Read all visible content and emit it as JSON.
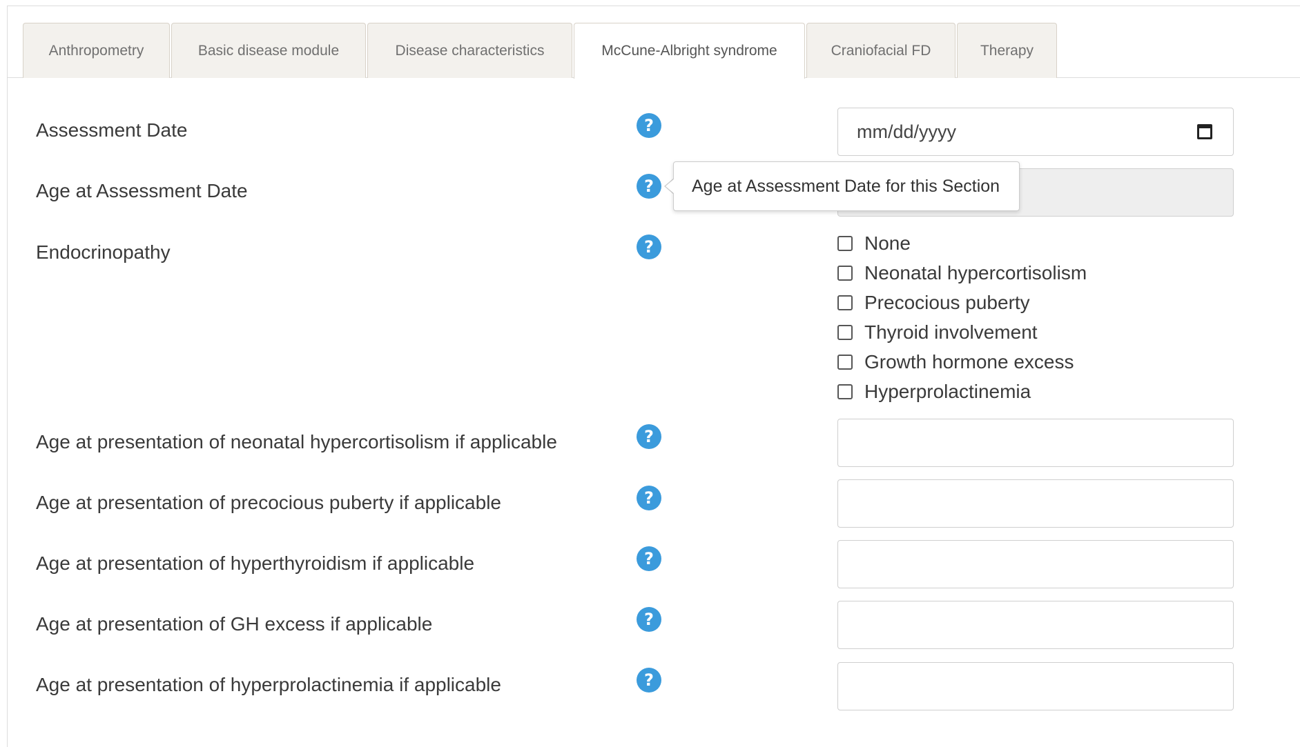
{
  "tabs": [
    {
      "label": "Anthropometry",
      "active": false
    },
    {
      "label": "Basic disease module",
      "active": false
    },
    {
      "label": "Disease characteristics",
      "active": false
    },
    {
      "label": "McCune-Albright syndrome",
      "active": true
    },
    {
      "label": "Craniofacial FD",
      "active": false
    },
    {
      "label": "Therapy",
      "active": false
    }
  ],
  "help_glyph": "?",
  "fields": {
    "assessment_date": {
      "label": "Assessment Date",
      "placeholder": "mm/dd/yyyy",
      "value": ""
    },
    "age_at_assessment": {
      "label": "Age at Assessment Date",
      "value": ""
    },
    "endocrinopathy": {
      "label": "Endocrinopathy",
      "options": [
        "None",
        "Neonatal hypercortisolism",
        "Precocious puberty",
        "Thyroid involvement",
        "Growth hormone excess",
        "Hyperprolactinemia"
      ]
    },
    "age_neonatal": {
      "label": "Age at presentation of neonatal hypercortisolism if applicable",
      "value": ""
    },
    "age_puberty": {
      "label": "Age at presentation of precocious puberty if applicable",
      "value": ""
    },
    "age_hyperthyroidism": {
      "label": "Age at presentation of hyperthyroidism if applicable",
      "value": ""
    },
    "age_gh": {
      "label": "Age at presentation of GH excess if applicable",
      "value": ""
    },
    "age_prolactin": {
      "label": "Age at presentation of hyperprolactinemia if applicable",
      "value": ""
    }
  },
  "tooltip": {
    "text": "Age at Assessment Date for this Section"
  },
  "colors": {
    "help_icon": "#3b9bdc",
    "readonly_field": "#eeeeee",
    "tab_inactive": "#f3f1ed"
  }
}
